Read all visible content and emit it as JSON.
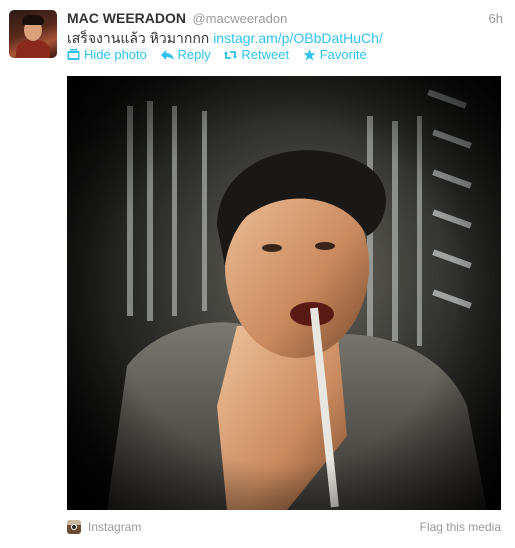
{
  "tweet": {
    "display_name": "MAC WEERADON",
    "handle": "@macweeradon",
    "time": "6h",
    "text": "เสร็จงานแล้ว หิวมากกก ",
    "link_text": "instagr.am/p/OBbDatHuCh/"
  },
  "actions": [
    {
      "label": "Hide photo",
      "icon": "photo-icon"
    },
    {
      "label": "Reply",
      "icon": "reply-icon"
    },
    {
      "label": "Retweet",
      "icon": "retweet-icon"
    },
    {
      "label": "Favorite",
      "icon": "star-icon"
    }
  ],
  "media_footer": {
    "source": "Instagram",
    "flag": "Flag this media"
  },
  "colors": {
    "link": "#2fc2ef",
    "muted": "#999999",
    "text": "#333333"
  }
}
